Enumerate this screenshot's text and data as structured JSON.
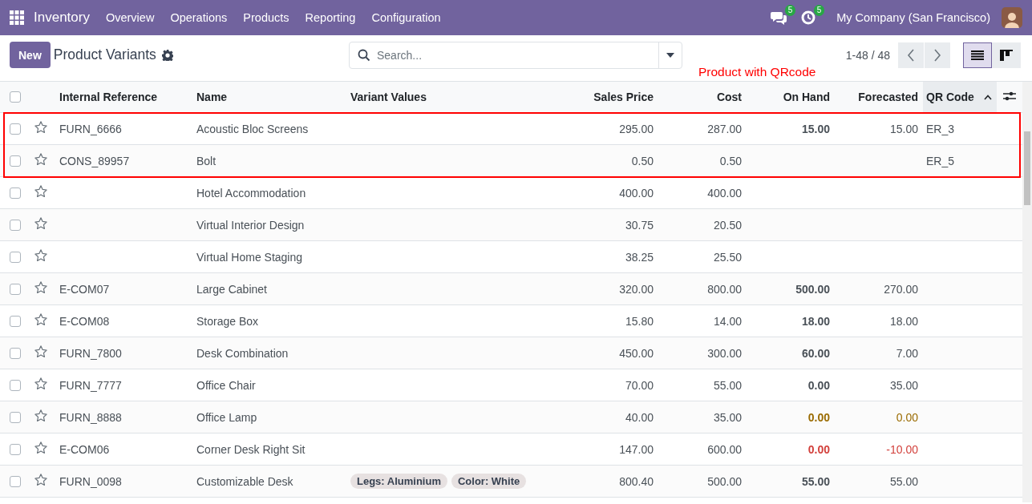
{
  "navbar": {
    "app_name": "Inventory",
    "menu": [
      "Overview",
      "Operations",
      "Products",
      "Reporting",
      "Configuration"
    ],
    "messages_badge": "5",
    "activities_badge": "5",
    "company": "My Company (San Francisco)"
  },
  "control_panel": {
    "new_button": "New",
    "title": "Product Variants",
    "search": {
      "placeholder": "Search..."
    },
    "pager": "1-48 / 48",
    "views": [
      {
        "kind": "list",
        "selected": true
      },
      {
        "kind": "kanban",
        "selected": false
      }
    ]
  },
  "annotation": {
    "label": "Product with QRcode"
  },
  "table": {
    "all_checked": false,
    "columns": [
      {
        "label": "Internal Reference",
        "kind": "text",
        "sorted": false
      },
      {
        "label": "Name",
        "kind": "text",
        "sorted": false
      },
      {
        "label": "Variant Values",
        "kind": "text",
        "sorted": false
      },
      {
        "label": "Sales Price",
        "kind": "number",
        "sorted": false
      },
      {
        "label": "Cost",
        "kind": "number",
        "sorted": false
      },
      {
        "label": "On Hand",
        "kind": "number",
        "sorted": false
      },
      {
        "label": "Forecasted",
        "kind": "number",
        "sorted": false
      },
      {
        "label": "QR Code",
        "kind": "text",
        "sorted": true
      }
    ],
    "rows": [
      {
        "checked": false,
        "favorite": false,
        "highlighted": true,
        "internal_reference": "FURN_6666",
        "name": "Acoustic Bloc Screens",
        "sales_price": "295.00",
        "cost": "287.00",
        "on_hand": "15.00",
        "forecasted": "15.00",
        "stock_warning": false,
        "stock_negative": false,
        "qr_code": "ER_3"
      },
      {
        "checked": false,
        "favorite": false,
        "highlighted": true,
        "internal_reference": "CONS_89957",
        "name": "Bolt",
        "sales_price": "0.50",
        "cost": "0.50",
        "qr_code": "ER_5"
      },
      {
        "checked": false,
        "favorite": false,
        "highlighted": false,
        "name": "Hotel Accommodation",
        "sales_price": "400.00",
        "cost": "400.00"
      },
      {
        "checked": false,
        "favorite": false,
        "highlighted": false,
        "name": "Virtual Interior Design",
        "sales_price": "30.75",
        "cost": "20.50"
      },
      {
        "checked": false,
        "favorite": false,
        "highlighted": false,
        "name": "Virtual Home Staging",
        "sales_price": "38.25",
        "cost": "25.50"
      },
      {
        "checked": false,
        "favorite": false,
        "highlighted": false,
        "internal_reference": "E-COM07",
        "name": "Large Cabinet",
        "sales_price": "320.00",
        "cost": "800.00",
        "on_hand": "500.00",
        "forecasted": "270.00",
        "stock_warning": false,
        "stock_negative": false
      },
      {
        "checked": false,
        "favorite": false,
        "highlighted": false,
        "internal_reference": "E-COM08",
        "name": "Storage Box",
        "sales_price": "15.80",
        "cost": "14.00",
        "on_hand": "18.00",
        "forecasted": "18.00",
        "stock_warning": false,
        "stock_negative": false
      },
      {
        "checked": false,
        "favorite": false,
        "highlighted": false,
        "internal_reference": "FURN_7800",
        "name": "Desk Combination",
        "sales_price": "450.00",
        "cost": "300.00",
        "on_hand": "60.00",
        "forecasted": "7.00",
        "stock_warning": false,
        "stock_negative": false
      },
      {
        "checked": false,
        "favorite": false,
        "highlighted": false,
        "internal_reference": "FURN_7777",
        "name": "Office Chair",
        "sales_price": "70.00",
        "cost": "55.00",
        "on_hand": "0.00",
        "forecasted": "35.00",
        "stock_warning": false,
        "stock_negative": false
      },
      {
        "checked": false,
        "favorite": false,
        "highlighted": false,
        "internal_reference": "FURN_8888",
        "name": "Office Lamp",
        "sales_price": "40.00",
        "cost": "35.00",
        "on_hand": "0.00",
        "forecasted": "0.00",
        "stock_warning": true,
        "stock_negative": false
      },
      {
        "checked": false,
        "favorite": false,
        "highlighted": false,
        "internal_reference": "E-COM06",
        "name": "Corner Desk Right Sit",
        "sales_price": "147.00",
        "cost": "600.00",
        "on_hand": "0.00",
        "forecasted": "-10.00",
        "stock_warning": false,
        "stock_negative": true
      },
      {
        "checked": false,
        "favorite": false,
        "highlighted": false,
        "internal_reference": "FURN_0098",
        "name": "Customizable Desk",
        "variant_values": [
          "Legs: Aluminium",
          "Color: White"
        ],
        "sales_price": "800.40",
        "cost": "500.00",
        "on_hand": "55.00",
        "forecasted": "55.00",
        "stock_warning": false,
        "stock_negative": false
      }
    ]
  }
}
